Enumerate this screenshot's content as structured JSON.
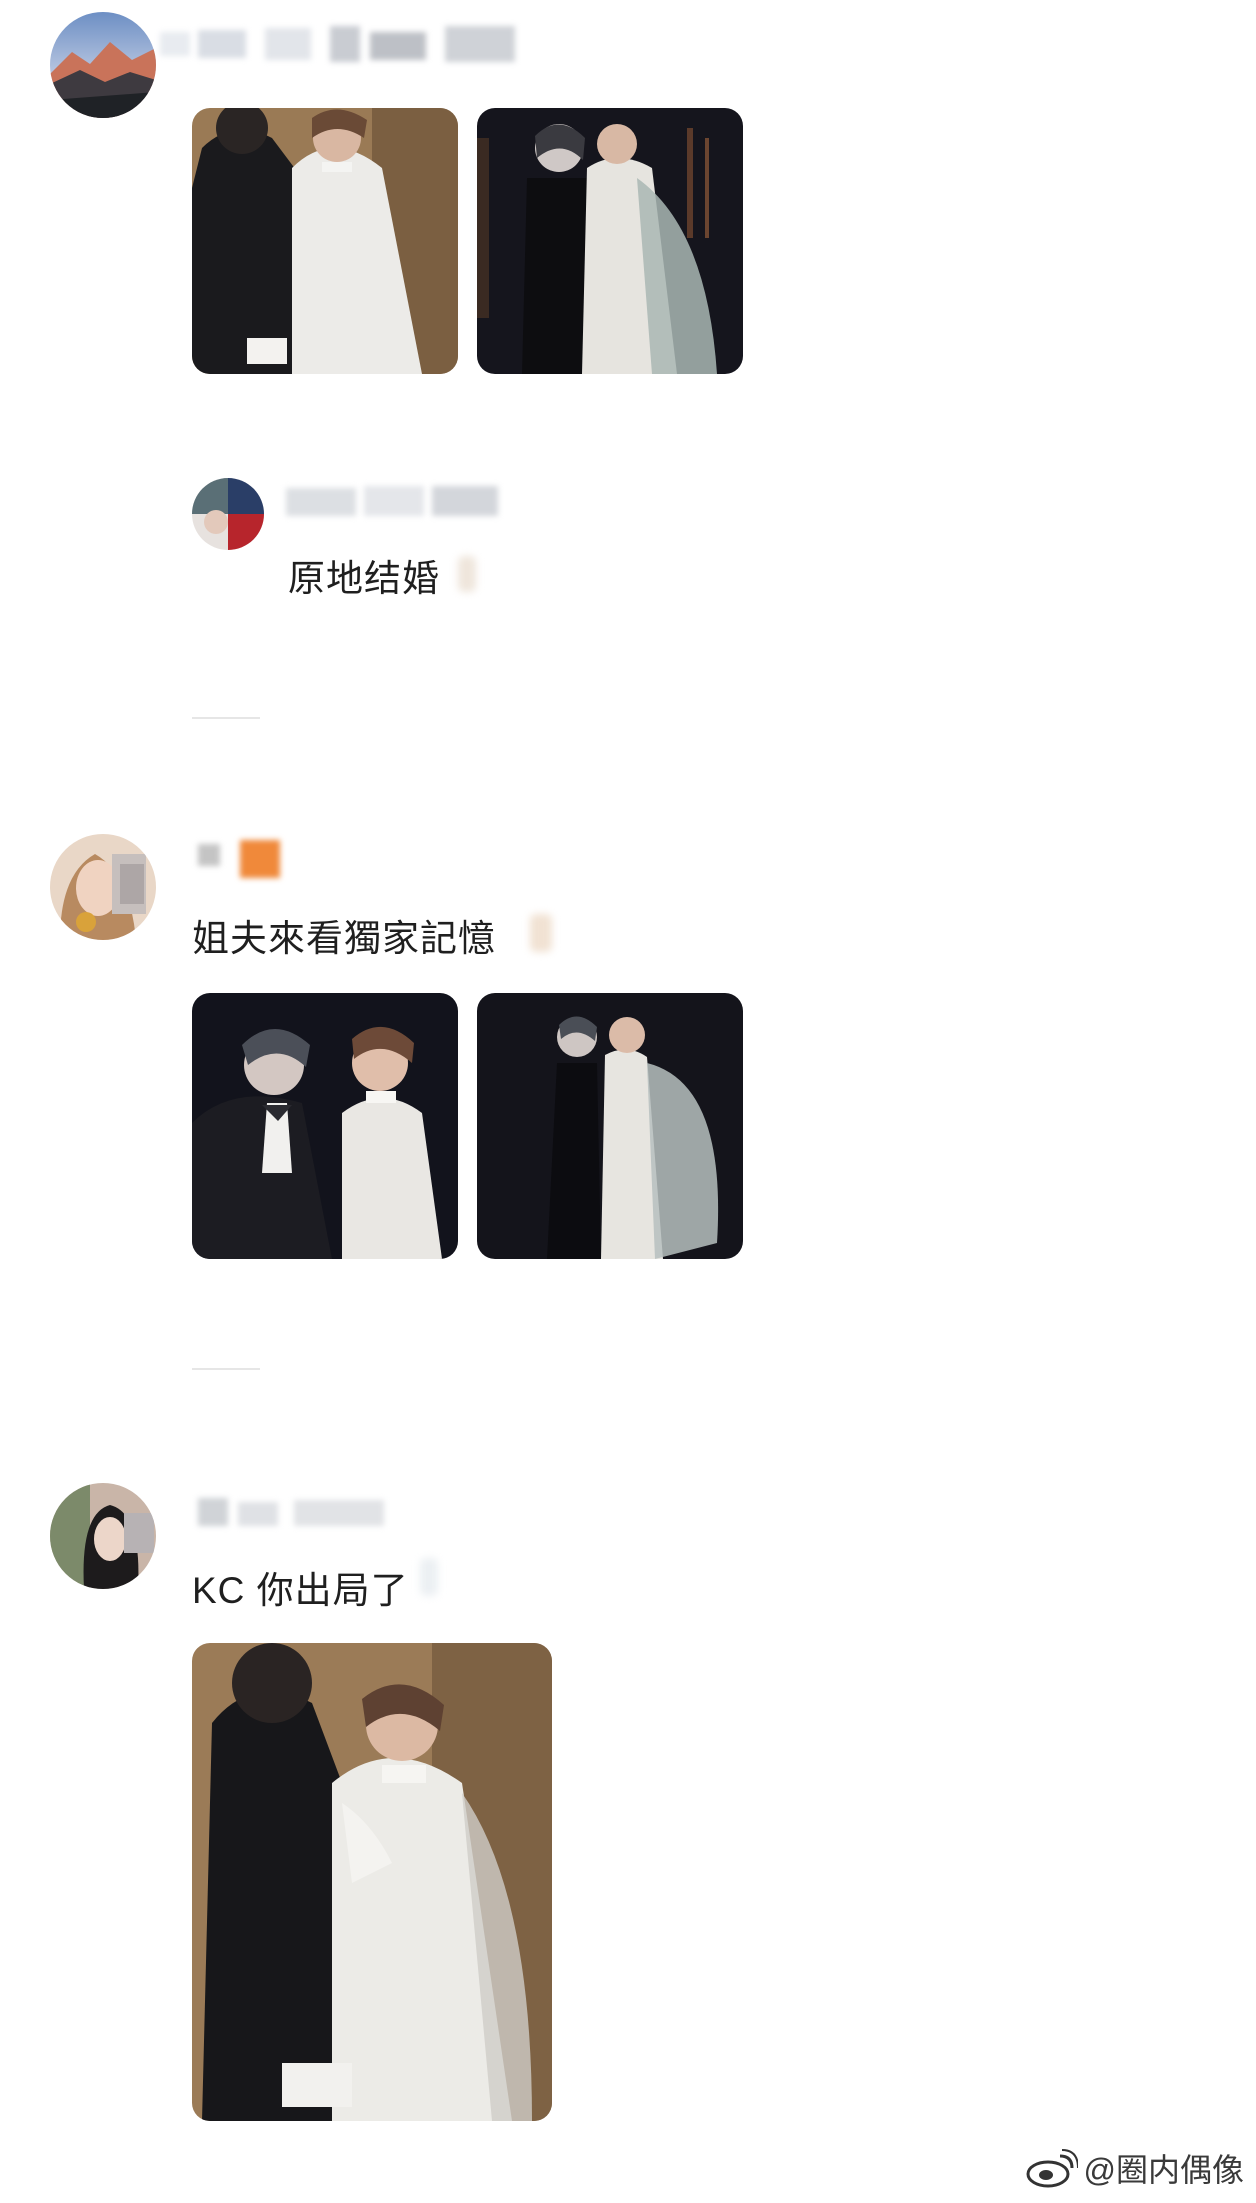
{
  "comments": [
    {
      "avatar": "mountain-sunset-avatar",
      "images": [
        "couple-photo-warm",
        "couple-photo-dark"
      ],
      "reply": {
        "text": "原地结婚"
      }
    },
    {
      "avatar": "woman-avatar",
      "text": "姐夫來看獨家記憶",
      "images": [
        "couple-photo-dark-closeup",
        "couple-photo-dark-veil"
      ]
    },
    {
      "avatar": "woman-dark-hair-avatar",
      "text": "KC 你出局了",
      "images": [
        "couple-photo-warm-large"
      ]
    }
  ],
  "watermark": {
    "text": "@圈内偶像",
    "icon": "weibo-logo-icon"
  },
  "colors": {
    "background": "#ffffff",
    "text": "#1f1f1f",
    "warm_bg": "#9a7a55",
    "dark_bg": "#15151d"
  }
}
